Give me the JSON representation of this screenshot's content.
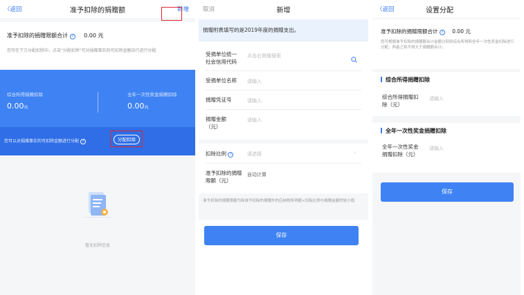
{
  "screen1": {
    "nav": {
      "back": "〈返回",
      "title": "准予扣除的捐赠额",
      "right": "新增"
    },
    "limit_label": "准予扣除的捐赠限额合计",
    "limit_value": "0.00 元",
    "hint": "您可在下方分配扣除中，点击\"分配扣除\"可对捐赠事实的可扣除金额自行进行分配",
    "card": {
      "left_label": "综合所得捐赠扣除",
      "left_value": "0.00",
      "right_label": "全年一次性奖金捐赠扣除",
      "right_value": "0.00",
      "unit": "元",
      "allocate_hint": "您可以对捐赠事实的可扣除金额进行分配",
      "allocate_button": "分配扣除"
    },
    "empty_text": "暂无扣除信息"
  },
  "screen2": {
    "nav": {
      "cancel": "取消",
      "title": "新增"
    },
    "banner": "捐赠附表填写的是2019年度的捐赠支出。",
    "fields": [
      {
        "label": "受捐单位统一社会信用代码",
        "placeholder": "点击右侧搜搜索"
      },
      {
        "label": "受捐单位名称",
        "placeholder": "请输入"
      },
      {
        "label": "捐赠凭证号",
        "placeholder": "请输入"
      },
      {
        "label": "捐赠金额（元）",
        "placeholder": "请输入"
      }
    ],
    "ratio_label": "扣除比例",
    "ratio_placeholder": "请选择",
    "limit_label": "准予扣除的捐赠限额（元）",
    "limit_value": "自动计算",
    "note": "准予扣除的捐赠限额为除准予扣除的捐赠外的应纳税所得额×扣除比例与捐赠金额的较小值",
    "save": "保存"
  },
  "screen3": {
    "nav": {
      "back": "〈返回",
      "title": "设置分配"
    },
    "limit_label": "准予扣除的捐赠限额合计",
    "limit_value": "0.00 元",
    "hint": "您可根据准予扣除的捐赠额合计金额分别到综合所得和全年一次性奖金扣除进行分配，两者之和不得大于捐赠额合计。",
    "section1": {
      "title": "综合所得捐赠扣除",
      "label": "综合所得捐赠扣除（元）",
      "placeholder": "请输入"
    },
    "section2": {
      "title": "全年一次性奖金捐赠扣除",
      "label": "全年一次性奖金捐赠扣除（元）",
      "placeholder": "请输入"
    },
    "save": "保存"
  },
  "colors": {
    "accent": "#3e82f3",
    "highlight": "#e0262e"
  }
}
